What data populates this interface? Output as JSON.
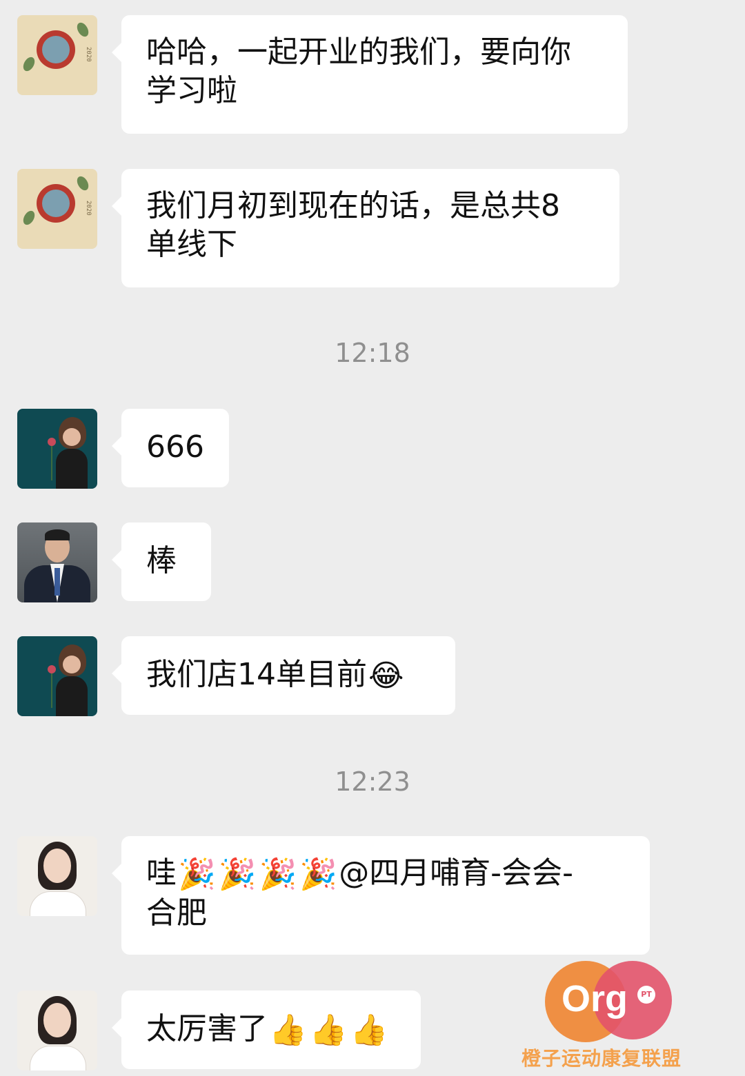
{
  "messages": [
    {
      "avatar": "calendar-avatar",
      "text_line1": "哈哈，一起开业的我们，要向你",
      "text_line2": "学习啦"
    },
    {
      "avatar": "calendar-avatar",
      "text_line1": "我们月初到现在的话，是总共8",
      "text_line2": "单线下"
    },
    {
      "avatar": "teal-portrait-avatar",
      "text": "666"
    },
    {
      "avatar": "suit-portrait-avatar",
      "text": "棒"
    },
    {
      "avatar": "teal-portrait-avatar",
      "text": "我们店14单目前",
      "emoji": "😂"
    },
    {
      "avatar": "light-portrait-avatar",
      "text_line1": "哇",
      "emojis": [
        "🎉",
        "🎉",
        "🎉",
        "🎉"
      ],
      "text_line1_tail": "@四月哺育-会会-",
      "text_line2": "合肥"
    },
    {
      "avatar": "light-portrait-avatar",
      "text": "太厉害了",
      "emojis": [
        "👍",
        "👍",
        "👍"
      ]
    }
  ],
  "timestamps": [
    "12:18",
    "12:23"
  ],
  "calendar_year": "2020",
  "watermark": {
    "logo": "Org",
    "badge": "PT",
    "name": "橙子运动康复联盟"
  },
  "colors": {
    "background": "#ededed",
    "bubble": "#ffffff",
    "timestamp": "#8f8f8f",
    "brand_orange": "#ef8a3a",
    "brand_pink": "#e2536a"
  }
}
